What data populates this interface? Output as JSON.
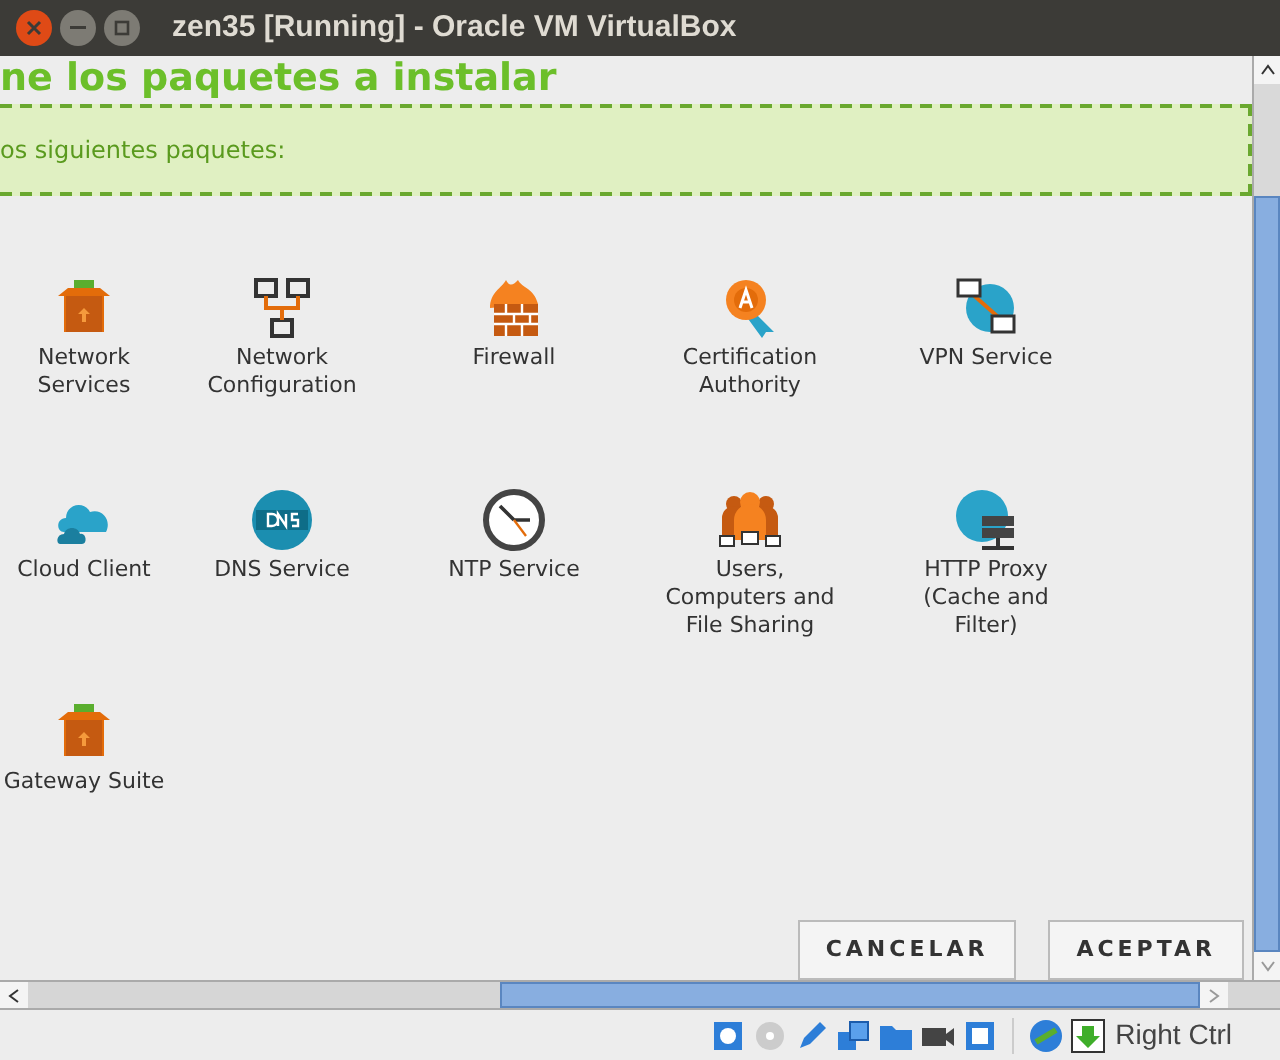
{
  "window": {
    "title": "zen35 [Running] - Oracle VM VirtualBox"
  },
  "heading": "ne los paquetes a instalar",
  "notice": "os siguientes paquetes:",
  "packages": [
    {
      "label": "Network\nServices",
      "kind": "box"
    },
    {
      "label": "Network\nConfiguration",
      "kind": "network"
    },
    {
      "label": "Firewall",
      "kind": "firewall"
    },
    {
      "label": "Certification\nAuthority",
      "kind": "certificate"
    },
    {
      "label": "VPN Service",
      "kind": "vpn"
    },
    {
      "label": "Cloud Client",
      "kind": "cloud"
    },
    {
      "label": "DNS Service",
      "kind": "dns"
    },
    {
      "label": "NTP Service",
      "kind": "clock"
    },
    {
      "label": "Users,\nComputers and\nFile Sharing",
      "kind": "users"
    },
    {
      "label": "HTTP Proxy\n(Cache and\nFilter)",
      "kind": "proxy"
    },
    {
      "label": "Gateway Suite",
      "kind": "box"
    }
  ],
  "buttons": [
    "CANCELAR",
    "ACEPTAR"
  ],
  "status_bar": {
    "host_key": "Right Ctrl"
  }
}
